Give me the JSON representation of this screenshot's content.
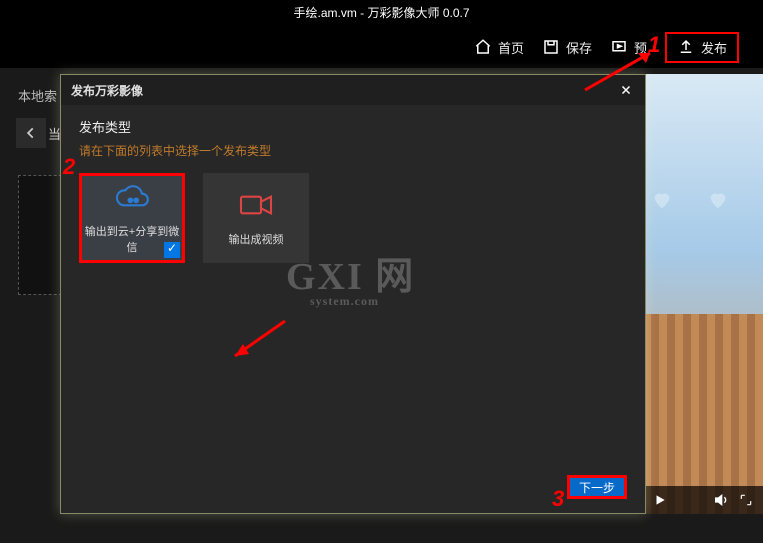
{
  "titlebar": "手绘.am.vm - 万彩影像大师 0.0.7",
  "toolbar": {
    "home": "首页",
    "save": "保存",
    "preview": "预",
    "publish": "发布"
  },
  "sidebar": {
    "search_hint": "本地索",
    "back_label": "当"
  },
  "dialog": {
    "title": "发布万彩影像",
    "section_title": "发布类型",
    "section_desc": "请在下面的列表中选择一个发布类型",
    "option_cloud": "输出到云+分享到微信",
    "option_video": "输出成视频",
    "next": "下一步"
  },
  "annotations": {
    "n1": "1",
    "n2": "2",
    "n3": "3"
  },
  "watermark": {
    "main": "GXI 网",
    "sub": "system.com"
  }
}
